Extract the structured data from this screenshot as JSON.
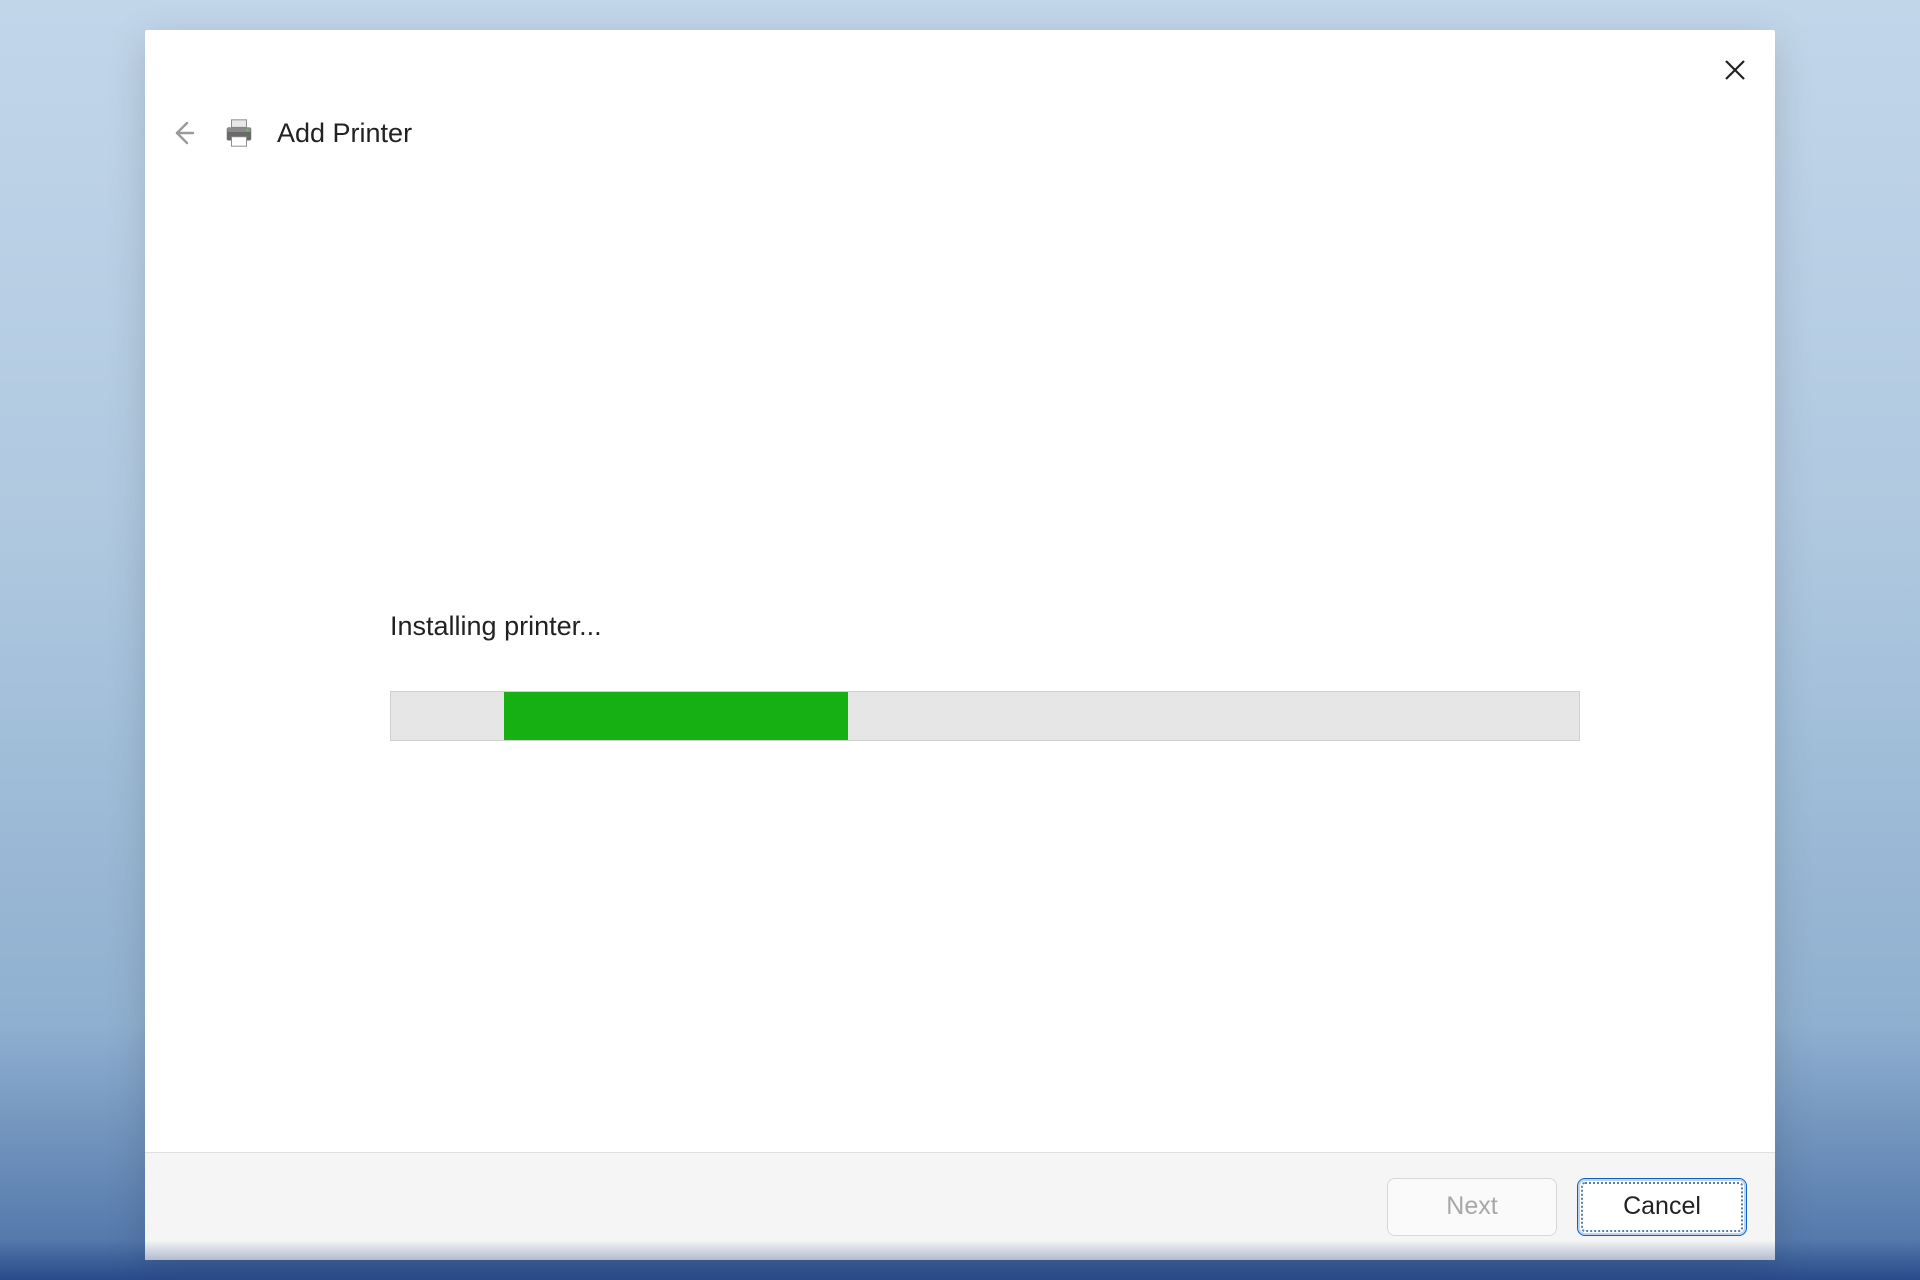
{
  "dialog": {
    "title": "Add Printer",
    "status_message": "Installing printer...",
    "progress": {
      "offset_percent": 9.5,
      "fill_percent": 29
    },
    "buttons": {
      "next": "Next",
      "cancel": "Cancel"
    }
  }
}
